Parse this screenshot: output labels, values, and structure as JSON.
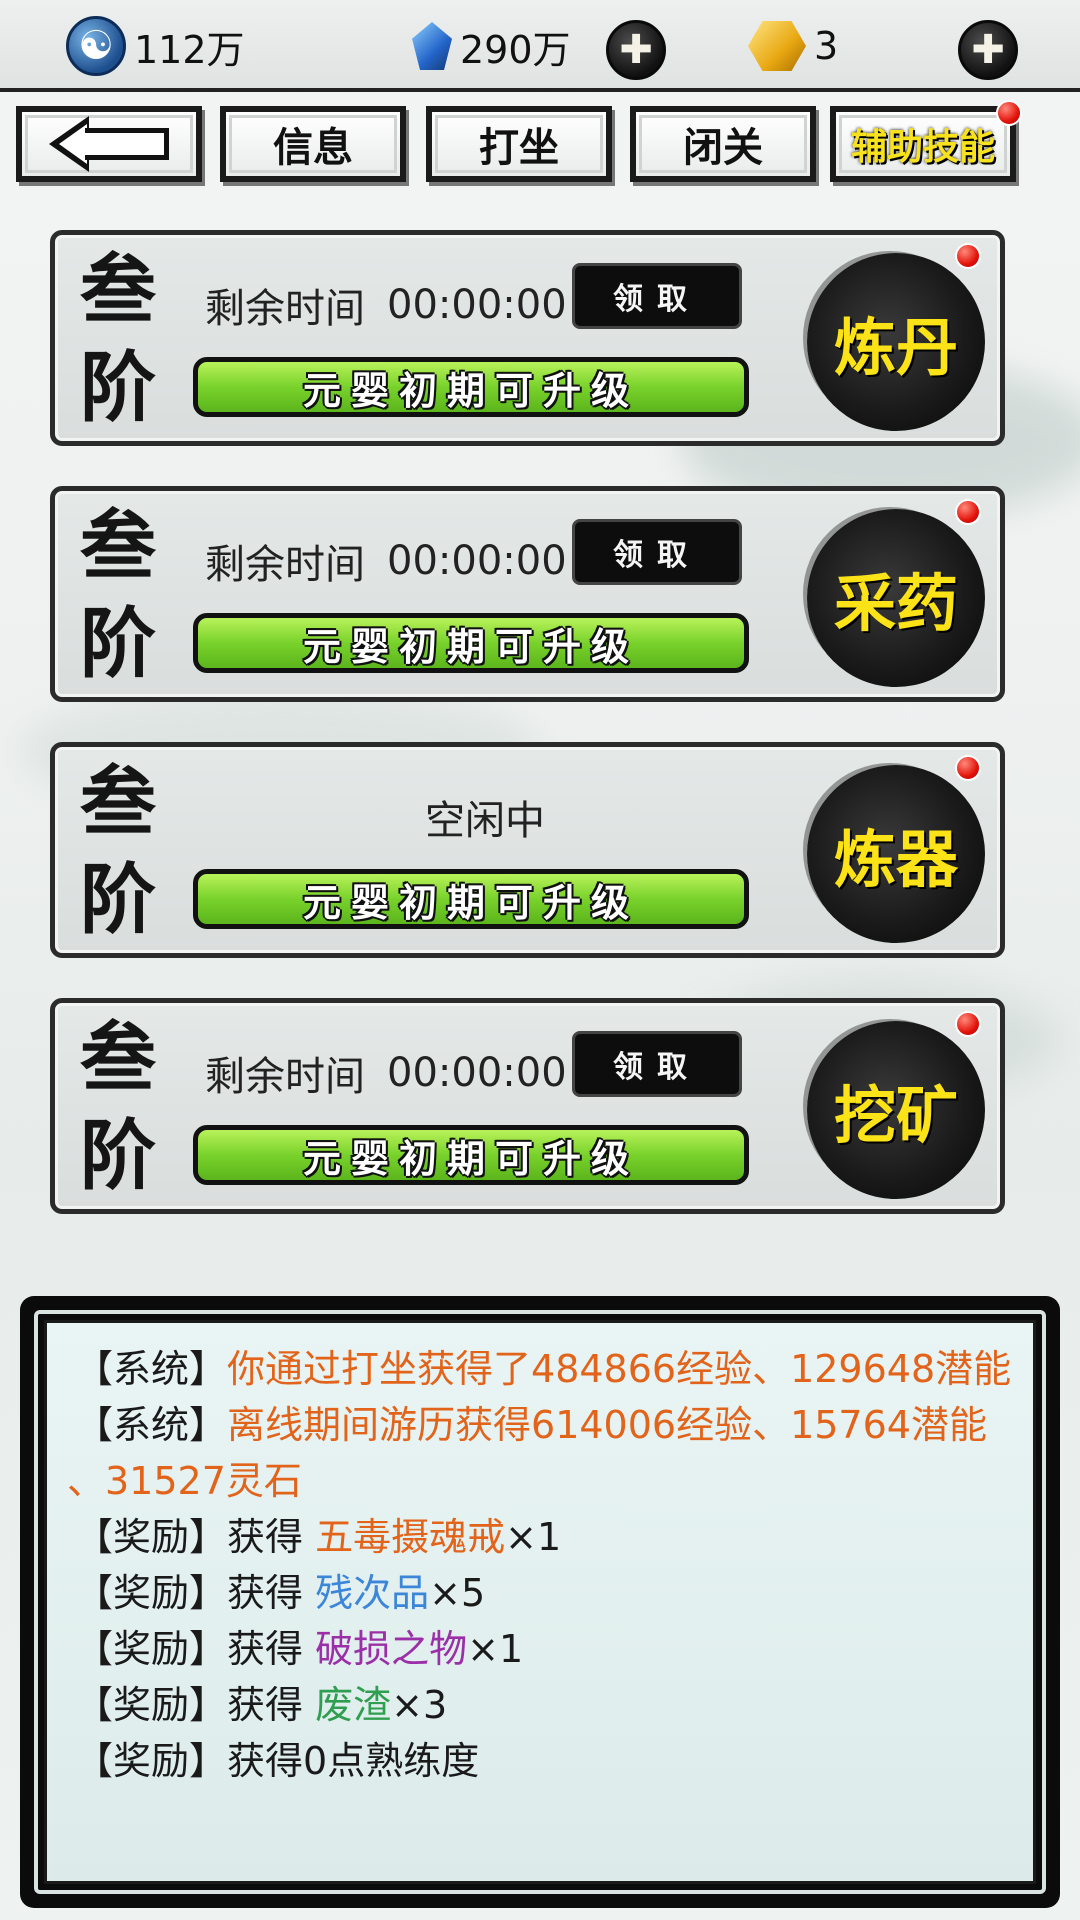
{
  "topbar": {
    "spirit": {
      "icon": "yinyang-icon",
      "value": "112万"
    },
    "gems": {
      "icon": "blue-gem-icon",
      "value": "290万"
    },
    "gold": {
      "icon": "gold-ingot-icon",
      "value": "3"
    },
    "plus_symbol": "✚"
  },
  "tabs": {
    "back_icon": "back-arrow-icon",
    "items": [
      "信息",
      "打坐",
      "闭关",
      "辅助技能"
    ],
    "active": "辅助技能"
  },
  "cards": [
    {
      "rank": [
        "叁",
        "阶"
      ],
      "time_label": "剩余时间",
      "time_value": "00:00:00",
      "claim": "领取",
      "status": "元婴初期可升级",
      "skill": "炼丹"
    },
    {
      "rank": [
        "叁",
        "阶"
      ],
      "time_label": "剩余时间",
      "time_value": "00:00:00",
      "claim": "领取",
      "status": "元婴初期可升级",
      "skill": "采药"
    },
    {
      "rank": [
        "叁",
        "阶"
      ],
      "idle": "空闲中",
      "status": "元婴初期可升级",
      "skill": "炼器"
    },
    {
      "rank": [
        "叁",
        "阶"
      ],
      "time_label": "剩余时间",
      "time_value": "00:00:00",
      "claim": "领取",
      "status": "元婴初期可升级",
      "skill": "挖矿"
    }
  ],
  "log": {
    "lines": [
      {
        "tag": "【系统】",
        "text": "你通过打坐获得了484866经验、129648潜能"
      },
      {
        "tag": "【系统】",
        "text": "离线期间游历获得614006经验、15764潜能"
      },
      {
        "tag": "",
        "text": "、31527灵石"
      },
      {
        "tag": "【奖励】",
        "prefix": "获得 ",
        "item": "五毒摄魂戒",
        "qty": "×1"
      },
      {
        "tag": "【奖励】",
        "prefix": "获得 ",
        "item": "残次品",
        "qty": "×5"
      },
      {
        "tag": "【奖励】",
        "prefix": "获得 ",
        "item": "破损之物",
        "qty": "×1"
      },
      {
        "tag": "【奖励】",
        "prefix": "获得 ",
        "item": "废渣",
        "qty": "×3"
      },
      {
        "tag": "【奖励】",
        "text": "获得0点熟练度"
      }
    ],
    "colors": {
      "system": "#e2631a",
      "orange_item": "#e2631a",
      "blue_item": "#3c86d9",
      "purple_item": "#9b2fa8",
      "green_item": "#2f9e50"
    }
  }
}
